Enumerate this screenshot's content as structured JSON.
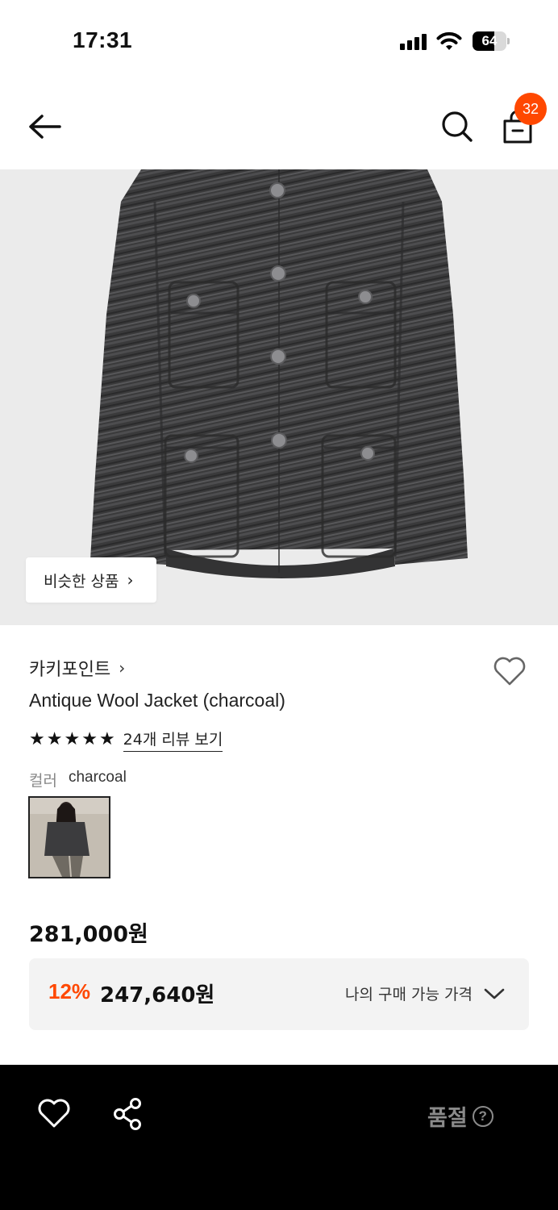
{
  "status_bar": {
    "time": "17:31",
    "battery_level": "64"
  },
  "header": {
    "back_icon": "arrow-left-icon",
    "search_icon": "search-icon",
    "cart_icon": "shopping-bag-icon",
    "cart_count": "32"
  },
  "product_image": {
    "similar_products_label": "비슷한 상품",
    "chevron": "›"
  },
  "product": {
    "brand": "카키포인트",
    "brand_chevron": "›",
    "name": "Antique Wool Jacket (charcoal)",
    "rating_stars": 5,
    "review_link": "24개 리뷰 보기",
    "color_label": "컬러",
    "color_value": "charcoal"
  },
  "pricing": {
    "original_price": "281,000원",
    "discount_rate": "12%",
    "discount_price": "247,640원",
    "my_price_label": "나의 구매 가능 가격"
  },
  "bottom_bar": {
    "heart_icon": "heart-icon",
    "share_icon": "share-icon",
    "soldout_label": "품절",
    "help_glyph": "?"
  },
  "colors": {
    "accent": "#ff4800",
    "bottom_bar_bg": "#000000",
    "image_bg": "#ebebeb",
    "price_box_bg": "#f3f3f3"
  }
}
